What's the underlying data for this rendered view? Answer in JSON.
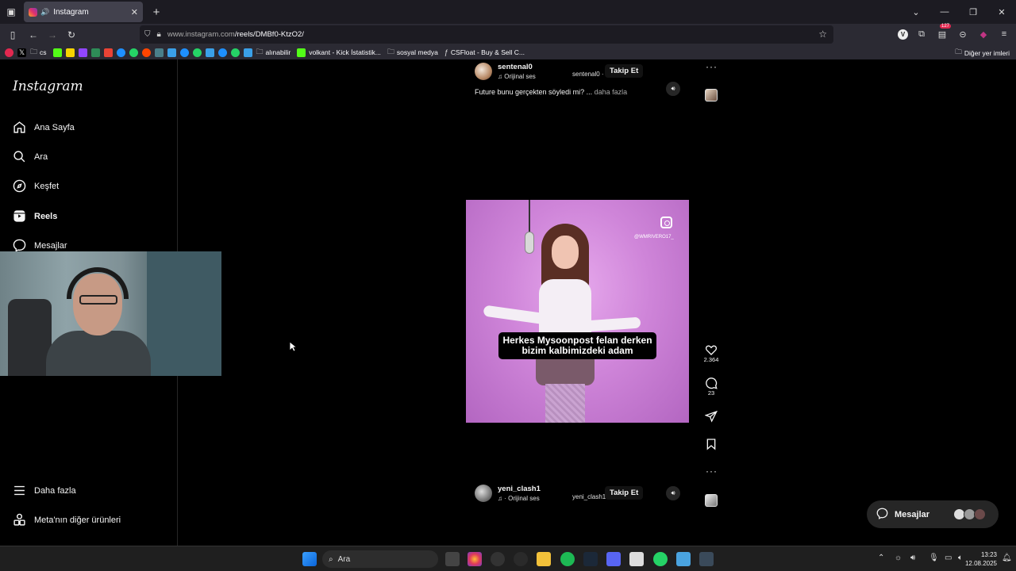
{
  "browser": {
    "tab_title": "Instagram",
    "tab_close": "✕",
    "new_tab": "+",
    "url_host": "www.instagram.com",
    "url_path": "/reels/DMBf0-KtzO2/",
    "badge_count": "127",
    "window_controls": [
      "—",
      "❐",
      "✕"
    ]
  },
  "bookmarks": {
    "items": [
      {
        "label": "cs",
        "folder": true
      },
      {
        "label": "alınabilir",
        "folder": true
      },
      {
        "label": "volkant - Kick İstatistik...",
        "folder": false
      },
      {
        "label": "sosyal medya",
        "folder": true
      },
      {
        "label": "CSFloat - Buy & Sell C...",
        "folder": false
      }
    ],
    "other": "Diğer yer imleri"
  },
  "instagram": {
    "logo": "Instagram",
    "nav": [
      {
        "label": "Ana Sayfa",
        "icon": "home-icon"
      },
      {
        "label": "Ara",
        "icon": "search-icon"
      },
      {
        "label": "Keşfet",
        "icon": "compass-icon"
      },
      {
        "label": "Reels",
        "icon": "reels-icon"
      },
      {
        "label": "Mesajlar",
        "icon": "messenger-icon"
      }
    ],
    "more": "Daha fazla",
    "meta_products": "Meta'nın diğer ürünleri"
  },
  "reel_top": {
    "username": "sentenal0",
    "audio": "Orijinal ses",
    "tag": "sentenal0 ·",
    "follow": "Takip Et",
    "caption": "Future bunu gerçekten söyledi mi? ...",
    "caption_more": "daha fazla"
  },
  "reel_main": {
    "overlay_handle": "@WMRIVERO17_",
    "subtitle_line1": "Herkes Mysoonpost felan derken",
    "subtitle_line2": "bizim kalbimizdeki adam",
    "likes": "2.364",
    "comments": "23"
  },
  "reel_bottom": {
    "username": "yeni_clash1",
    "audio": "· Orijinal ses",
    "tag": "yeni_clash1",
    "follow": "Takip Et"
  },
  "messages_button": "Mesajlar",
  "taskbar": {
    "search_placeholder": "Ara",
    "time": "13:23",
    "date": "12.08.2025"
  }
}
